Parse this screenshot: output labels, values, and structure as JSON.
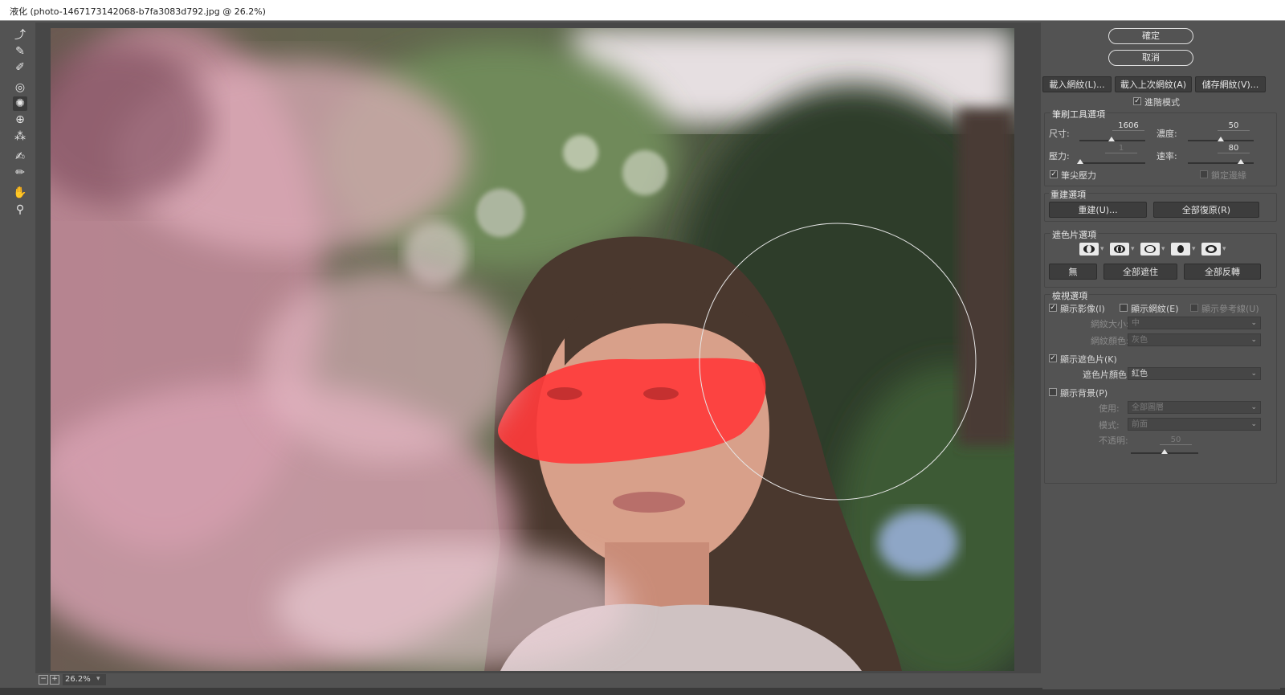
{
  "window": {
    "title": "液化 (photo-1467173142068-b7fa3083d792.jpg @ 26.2%)"
  },
  "tools": [
    {
      "name": "forward-warp-tool-icon",
      "glyph": "☝"
    },
    {
      "name": "reconstruct-tool-icon",
      "glyph": "✎"
    },
    {
      "name": "smooth-tool-icon",
      "glyph": "✐"
    },
    {
      "name": "twirl-tool-icon",
      "glyph": "◎"
    },
    {
      "name": "pucker-tool-icon",
      "glyph": "✺"
    },
    {
      "name": "bloat-tool-icon",
      "glyph": "⊕"
    },
    {
      "name": "push-left-tool-icon",
      "glyph": "⁂"
    },
    {
      "name": "freeze-mask-tool-icon",
      "glyph": "✍"
    },
    {
      "name": "thaw-mask-tool-icon",
      "glyph": "✏"
    },
    {
      "name": "hand-tool-icon",
      "glyph": "✋"
    },
    {
      "name": "zoom-tool-icon",
      "glyph": "🔍"
    }
  ],
  "status": {
    "zoom": "26.2%"
  },
  "panel": {
    "ok": "確定",
    "cancel": "取消",
    "load_mesh": "載入網紋(L)...",
    "load_last_mesh": "載入上次網紋(A)",
    "save_mesh": "儲存網紋(V)...",
    "advanced_mode": "進階模式",
    "brush_options": {
      "title": "筆刷工具選項",
      "size_label": "尺寸:",
      "size_value": "1606",
      "density_label": "濃度:",
      "density_value": "50",
      "pressure_label": "壓力:",
      "pressure_value": "1",
      "rate_label": "速率:",
      "rate_value": "80",
      "stylus_pressure": "筆尖壓力",
      "pin_edges": "鎖定邊緣"
    },
    "reconstruct": {
      "title": "重建選項",
      "reconstruct_btn": "重建(U)...",
      "restore_all": "全部復原(R)"
    },
    "mask": {
      "title": "遮色片選項",
      "none": "無",
      "mask_all": "全部遮住",
      "invert_all": "全部反轉"
    },
    "view": {
      "title": "檢視選項",
      "show_image": "顯示影像(I)",
      "show_mesh": "顯示網紋(E)",
      "show_guides": "顯示參考線(U)",
      "mesh_size_label": "網紋大小:",
      "mesh_size_value": "中",
      "mesh_color_label": "網紋顏色:",
      "mesh_color_value": "灰色",
      "show_mask": "顯示遮色片(K)",
      "mask_color_label": "遮色片顏色:",
      "mask_color_value": "紅色",
      "show_backdrop": "顯示背景(P)",
      "use_label": "使用:",
      "use_value": "全部圖層",
      "mode_label": "模式:",
      "mode_value": "前面",
      "opacity_label": "不透明:",
      "opacity_value": "50"
    }
  },
  "colors": {
    "panel_bg": "#535353",
    "mask_red": "#ff3b3b"
  }
}
